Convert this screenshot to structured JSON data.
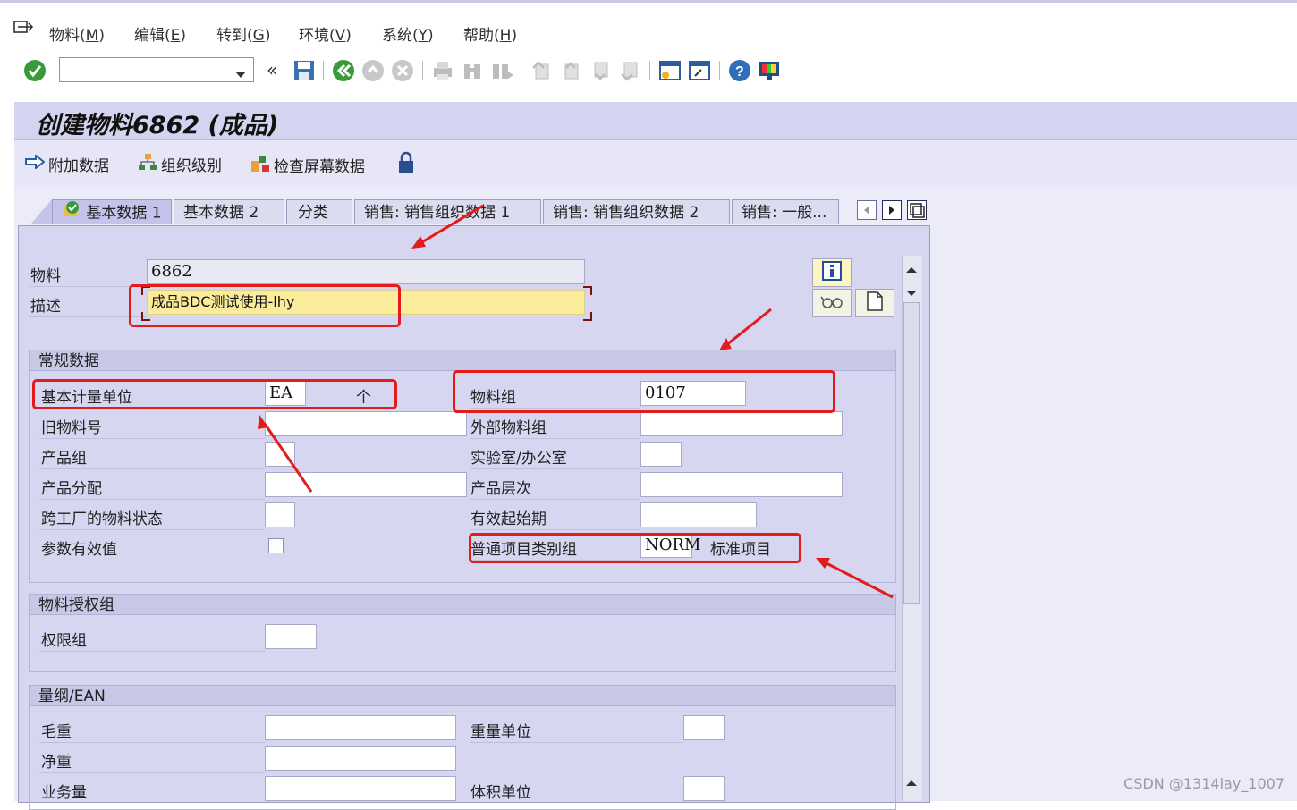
{
  "menu": {
    "items": [
      {
        "text": "物料(",
        "key": "M",
        "end": ")"
      },
      {
        "text": "编辑(",
        "key": "E",
        "end": ")"
      },
      {
        "text": "转到(",
        "key": "G",
        "end": ")"
      },
      {
        "text": "环境(",
        "key": "V",
        "end": ")"
      },
      {
        "text": "系统(",
        "key": "Y",
        "end": ")"
      },
      {
        "text": "帮助(",
        "key": "H",
        "end": ")"
      }
    ]
  },
  "toolbar": {
    "command_value": "",
    "collapse_label": "«"
  },
  "page_title": "创建物料6862 (成品)",
  "app_toolbar": {
    "additional_data": "附加数据",
    "org_levels": "组织级别",
    "check_screen_data": "检查屏幕数据"
  },
  "tabs": [
    {
      "label": "基本数据 1"
    },
    {
      "label": "基本数据 2"
    },
    {
      "label": "分类"
    },
    {
      "label": "销售: 销售组织数据 1"
    },
    {
      "label": "销售: 销售组织数据 2"
    },
    {
      "label": "销售: 一般..."
    }
  ],
  "header_fields": {
    "material_label": "物料",
    "material_value": "6862",
    "description_label": "描述",
    "description_value": "成品BDC测试使用-lhy"
  },
  "general_data": {
    "title": "常规数据",
    "base_uom_label": "基本计量单位",
    "base_uom_value": "EA",
    "base_uom_text": "个",
    "material_group_label": "物料组",
    "material_group_value": "0107",
    "old_material_label": "旧物料号",
    "old_material_value": "",
    "ext_material_group_label": "外部物料组",
    "ext_material_group_value": "",
    "division_label": "产品组",
    "division_value": "",
    "lab_office_label": "实验室/办公室",
    "lab_office_value": "",
    "product_alloc_label": "产品分配",
    "product_alloc_value": "",
    "product_hierarchy_label": "产品层次",
    "product_hierarchy_value": "",
    "cross_plant_status_label": "跨工厂的物料状态",
    "cross_plant_status_value": "",
    "valid_from_label": "有效起始期",
    "valid_from_value": "",
    "param_effectivity_label": "参数有效值",
    "item_cat_group_label": "普通项目类别组",
    "item_cat_group_value": "NORM",
    "item_cat_group_text": "标准项目"
  },
  "auth_group": {
    "title": "物料授权组",
    "auth_group_label": "权限组",
    "auth_group_value": ""
  },
  "dimensions": {
    "title": "量纲/EAN",
    "gross_weight_label": "毛重",
    "gross_weight_value": "",
    "weight_unit_label": "重量单位",
    "weight_unit_value": "",
    "net_weight_label": "净重",
    "net_weight_value": "",
    "volume_label": "业务量",
    "volume_value": "",
    "volume_unit_label": "体积单位",
    "volume_unit_value": ""
  },
  "watermark": "CSDN @1314lay_1007",
  "colors": {
    "annotation_red": "#e21b1b",
    "title_bg": "#d4d4f0",
    "tab_body_bg": "#d6d6f1",
    "field_highlight": "#fbec9c"
  }
}
